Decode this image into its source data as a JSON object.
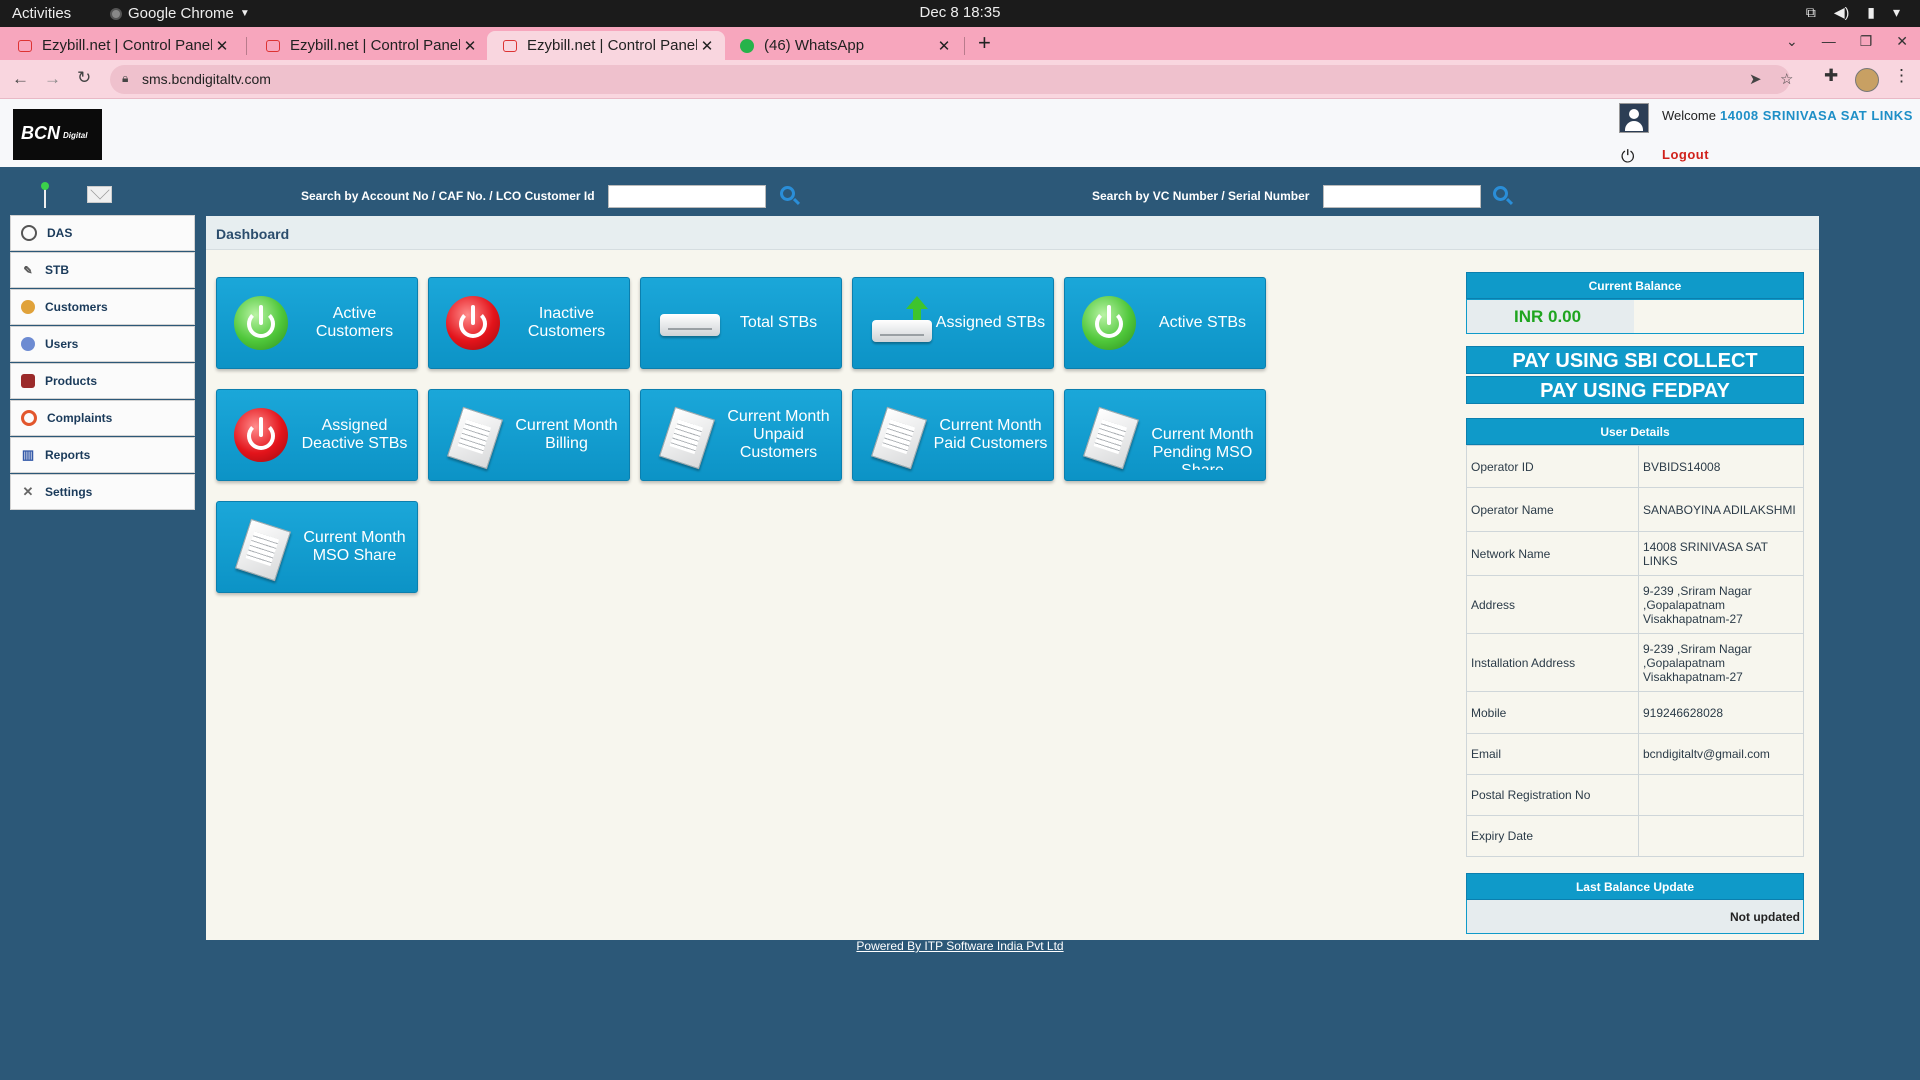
{
  "system": {
    "activities": "Activities",
    "app_name": "Google Chrome",
    "clock": "Dec 8  18:35"
  },
  "browser": {
    "tabs": [
      {
        "title": "Ezybill.net | Control Panel"
      },
      {
        "title": "Ezybill.net | Control Panel"
      },
      {
        "title": "Ezybill.net | Control Panel"
      },
      {
        "title": "(46) WhatsApp"
      }
    ],
    "url": "sms.bcndigitaltv.com"
  },
  "header": {
    "logo_main": "BCN",
    "logo_sub": "Digital",
    "welcome_label": "Welcome",
    "welcome_name": "14008 SRINIVASA SAT LINKS",
    "logout_label": "Logout"
  },
  "search": {
    "account_label": "Search by Account No / CAF No. / LCO Customer Id",
    "account_value": "",
    "vc_label": "Search by VC Number / Serial Number",
    "vc_value": ""
  },
  "sidebar": {
    "items": [
      {
        "label": "DAS",
        "icon": "disc-icon"
      },
      {
        "label": "STB",
        "icon": "pen-icon"
      },
      {
        "label": "Customers",
        "icon": "customer-icon"
      },
      {
        "label": "Users",
        "icon": "users-icon"
      },
      {
        "label": "Products",
        "icon": "products-icon"
      },
      {
        "label": "Complaints",
        "icon": "lifebuoy-icon"
      },
      {
        "label": "Reports",
        "icon": "report-icon"
      },
      {
        "label": "Settings",
        "icon": "tools-icon"
      }
    ]
  },
  "main": {
    "title": "Dashboard",
    "tiles": [
      {
        "label": "Active Customers",
        "icon": "power-green-icon"
      },
      {
        "label": "Inactive Customers",
        "icon": "power-red-icon"
      },
      {
        "label": "Total STBs",
        "icon": "set-top-box-icon"
      },
      {
        "label": "Assigned STBs",
        "icon": "set-top-box-upload-icon"
      },
      {
        "label": "Active STBs",
        "icon": "power-green-icon"
      },
      {
        "label": "Assigned Deactive STBs",
        "icon": "power-red-icon"
      },
      {
        "label": "Current Month Billing",
        "icon": "invoice-icon"
      },
      {
        "label": "Current Month Unpaid Customers",
        "icon": "invoice-icon"
      },
      {
        "label": "Current Month Paid Customers",
        "icon": "invoice-icon"
      },
      {
        "label": "Current Month Pending MSO Share",
        "icon": "invoice-icon"
      },
      {
        "label": "Current Month MSO Share",
        "icon": "invoice-icon"
      }
    ]
  },
  "balance": {
    "title": "Current Balance",
    "value": "INR 0.00",
    "value_color": "#1fa51f"
  },
  "pay_buttons": {
    "sbi": "PAY USING SBI COLLECT",
    "fedpay": "PAY USING FEDPAY"
  },
  "user_details": {
    "title": "User Details",
    "rows": [
      {
        "key": "Operator ID",
        "value": "BVBIDS14008"
      },
      {
        "key": "Operator Name",
        "value": "SANABOYINA ADILAKSHMI"
      },
      {
        "key": "Network Name",
        "value": "14008 SRINIVASA SAT LINKS"
      },
      {
        "key": "Address",
        "value": "9-239 ,Sriram Nagar ,Gopalapatnam Visakhapatnam-27"
      },
      {
        "key": "Installation Address",
        "value": "9-239 ,Sriram Nagar ,Gopalapatnam Visakhapatnam-27"
      },
      {
        "key": "Mobile",
        "value": "919246628028"
      },
      {
        "key": "Email",
        "value": "bcndigitaltv@gmail.com"
      },
      {
        "key": "Postal Registration No",
        "value": ""
      },
      {
        "key": "Expiry Date",
        "value": ""
      }
    ]
  },
  "last_balance_update": {
    "title": "Last Balance Update",
    "value": "Not updated"
  },
  "footer": {
    "powered_by": "Powered By ITP Software India Pvt Ltd"
  },
  "colors": {
    "page_bg": "#2c5878",
    "tile_blue": "#1ba7d9",
    "accent_blue": "#1e8fc7",
    "logout_red": "#d0211b",
    "tab_strip_pink": "#f7a6bd"
  }
}
